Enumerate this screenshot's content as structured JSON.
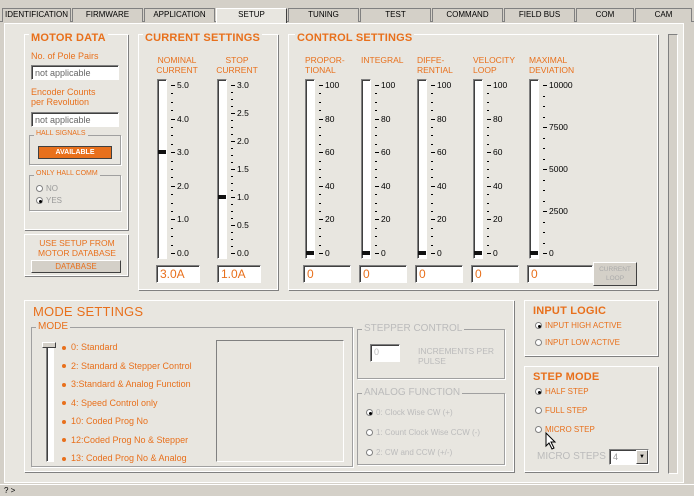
{
  "tabs": [
    "IDENTIFICATION",
    "FIRMWARE",
    "APPLICATION",
    "SETUP",
    "TUNING",
    "TEST",
    "COMMAND",
    "FIELD BUS",
    "COM",
    "CAM"
  ],
  "motor_data": {
    "title": "MOTOR DATA",
    "pole_pairs_label": "No. of Pole Pairs",
    "pole_pairs_value": "not applicable",
    "encoder_label_1": "Encoder Counts",
    "encoder_label_2": "per Revolution",
    "encoder_value": "not applicable",
    "hall_group": "HALL SIGNALS",
    "hall_status": "AVAILABLE",
    "only_hall_group": "ONLY HALL COMM",
    "no_label": "NO",
    "yes_label": "YES",
    "yes_selected": true
  },
  "database": {
    "line1": "USE SETUP FROM",
    "line2": "MOTOR DATABASE",
    "button": "DATABASE"
  },
  "current_settings": {
    "title": "CURRENT SETTINGS",
    "nominal_label_1": "NOMINAL",
    "nominal_label_2": "CURRENT",
    "stop_label_1": "STOP",
    "stop_label_2": "CURRENT",
    "nominal_ticks": [
      "5.0",
      "4.0",
      "3.0",
      "2.0",
      "1.0",
      "0.0"
    ],
    "stop_ticks": [
      "3.0",
      "2.5",
      "2.0",
      "1.5",
      "1.0",
      "0.5",
      "0.0"
    ],
    "nominal_value": "3.0A",
    "stop_value": "1.0A",
    "nominal_level": 0.6,
    "stop_level": 0.333
  },
  "control_settings": {
    "title": "CONTROL SETTINGS",
    "sliders": [
      {
        "label1": "PROPOR-",
        "label2": "TIONAL",
        "ticks": [
          "100",
          "80",
          "60",
          "40",
          "20",
          "0"
        ],
        "value": "0",
        "level": 0
      },
      {
        "label1": "INTEGRAL",
        "label2": "",
        "ticks": [
          "100",
          "80",
          "60",
          "40",
          "20",
          "0"
        ],
        "value": "0",
        "level": 0
      },
      {
        "label1": "DIFFE-",
        "label2": "RENTIAL",
        "ticks": [
          "100",
          "80",
          "60",
          "40",
          "20",
          "0"
        ],
        "value": "0",
        "level": 0
      },
      {
        "label1": "VELOCITY",
        "label2": "LOOP",
        "ticks": [
          "100",
          "80",
          "60",
          "40",
          "20",
          "0"
        ],
        "value": "0",
        "level": 0
      },
      {
        "label1": "MAXIMAL",
        "label2": "DEVIATION",
        "ticks": [
          "10000",
          "7500",
          "5000",
          "2500",
          "0"
        ],
        "value": "0",
        "level": 0
      }
    ],
    "current_loop_1": "CURRENT",
    "current_loop_2": "LOOP"
  },
  "mode_settings": {
    "title": "MODE SETTINGS",
    "mode_group": "MODE",
    "modes": [
      "0: Standard",
      "2: Standard & Stepper Control",
      "3:Standard &  Analog Function",
      "4: Speed Control only",
      "10: Coded  Prog No",
      "12:Coded Prog No & Stepper",
      "13: Coded Prog No &  Analog"
    ],
    "stepper_title": "STEPPER CONTROL",
    "increments_value": "0",
    "increments_label_1": "INCREMENTS PER",
    "increments_label_2": "PULSE",
    "analog_title": "ANALOG FUNCTION",
    "analog_options": [
      "0: Clock Wise CW (+)",
      "1: Count  Clock Wise CCW (-)",
      "2: CW and CCW (+/-)"
    ]
  },
  "input_logic": {
    "title": "INPUT LOGIC",
    "options": [
      "INPUT HIGH ACTIVE",
      "INPUT LOW ACTIVE"
    ],
    "selected": 0
  },
  "step_mode": {
    "title": "STEP MODE",
    "options": [
      "HALF STEP",
      "FULL STEP",
      "MICRO STEP"
    ],
    "selected": 0,
    "micro_label": "MICRO STEPS",
    "micro_value": "4"
  },
  "status_bar": "? >"
}
